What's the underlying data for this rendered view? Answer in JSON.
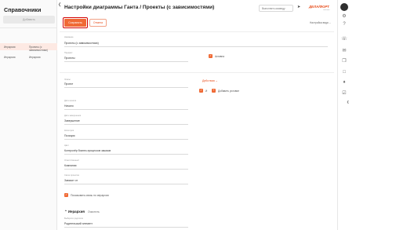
{
  "sidebar": {
    "title": "Справочники",
    "add_label": "Добавить",
    "rows": [
      {
        "col1": "Иерархия",
        "col2": "Проекты (с зависимостями)",
        "active": true
      },
      {
        "col1": "Иерархия",
        "col2": "Иерархия",
        "active": false
      }
    ]
  },
  "header": {
    "title": "Настройки диаграммы Ганта / Проекты (с зависимостями)",
    "search_placeholder": "Выполнить команду",
    "brand_main": "ДЕЛА/ФОРТ",
    "brand_sub": "система"
  },
  "toolbar": {
    "save_label": "Сохранить",
    "cancel_label": "Отмена",
    "form_settings_label": "Настройка вида"
  },
  "form": {
    "name_label": "Название",
    "name_value": "Проекты (с зависимостями)",
    "subject_label": "Предмет",
    "subject_value": "Проекты",
    "active_label": "Активна",
    "stage_label": "Этапы",
    "stage_value": "Проект",
    "start_label": "Дата начала",
    "start_value": "Начало",
    "end_label": "Дата завершения",
    "end_value": "Завершение",
    "category_label": "Категория",
    "category_value": "Позиция",
    "color_label": "Цвет",
    "color_value": "Контролёр бизнес-процессов заказов",
    "resp_label": "Ответственный",
    "resp_value": "Компания",
    "links_label": "Связи проектов",
    "links_value": "Зависит от",
    "show_links_label": "Показывать связь по иерархии",
    "actions_label": "Действия",
    "check_x_label": "И",
    "add_conditions_label": "Добавить условие"
  },
  "hierarchy": {
    "title": "Иерархия",
    "clear_label": "Очистить",
    "parent_label": "Выберите родителя",
    "parent_value": "Родительский элемент"
  },
  "colors": {
    "accent": "#f06a35",
    "highlight_border": "#d40000",
    "active_row": "#fde9e3"
  },
  "icons": {
    "rail": [
      "avatar",
      "gear-icon",
      "help-icon",
      "phone-icon",
      "mail-icon",
      "copy-icon",
      "chat-icon",
      "bell-icon",
      "task-icon"
    ]
  }
}
